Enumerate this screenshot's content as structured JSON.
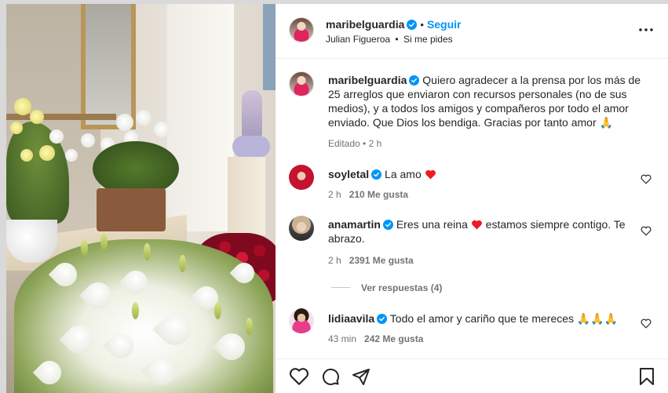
{
  "header": {
    "username": "maribelguardia",
    "separator": "•",
    "follow_label": "Seguir",
    "song_artist": "Julian Figueroa",
    "song_separator": "•",
    "song_title": "Si me pides"
  },
  "caption": {
    "username": "maribelguardia",
    "text": "Quiero agradecer a la prensa por los más de 25 arreglos que enviaron con recursos personales (no de sus medios), y a todos los amigos y compañeros por todo el amor enviado. Que Dios los bendiga. Gracias por tanto amor 🙏",
    "meta": "Editado • 2 h"
  },
  "comments": [
    {
      "username": "soyletal",
      "text_before": "La amo ",
      "text_after": "",
      "time": "2 h",
      "likes": "210 Me gusta"
    },
    {
      "username": "anamartin",
      "text_before": "Eres una reina ",
      "text_after": " estamos siempre contigo. Te abrazo.",
      "time": "2 h",
      "likes": "2391 Me gusta"
    },
    {
      "username": "lidiaavila",
      "text_before": "Todo el amor y cariño que te mereces ",
      "text_after": "🙏🙏🙏",
      "time": "43 min",
      "likes": "242 Me gusta"
    }
  ],
  "replies_label": "Ver respuestas (4)",
  "colors": {
    "accent": "#0095f6",
    "heart": "#ed1b24",
    "muted": "#737373"
  },
  "icons": [
    "more-options-icon",
    "verified-icon",
    "heart-icon",
    "comment-icon",
    "share-icon",
    "bookmark-icon"
  ]
}
